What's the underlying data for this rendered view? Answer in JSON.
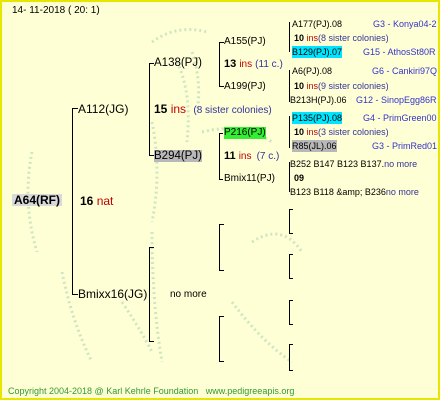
{
  "header": {
    "date": "14- 11-2018 ( 20: 1)"
  },
  "colors": {
    "frame": "#e6e600",
    "background": "#ffffd6",
    "root_box": "#d9d9d9",
    "gray_box": "#b8b8b8",
    "green_box": "#33ee33",
    "cyan_box": "#00e5ff",
    "ins_red": "#c00000",
    "link_blue": "#3333cc",
    "footer_green": "#339933"
  },
  "root": {
    "name": "A64(RF)",
    "ins_count": "16",
    "ins_label": "nat"
  },
  "gen1": {
    "father": {
      "name": "A112(JG)",
      "ins_count": "15",
      "ins_label": "ins",
      "note": "(8 sister colonies)"
    },
    "mother": {
      "name": "Bmixx16(JG)",
      "note": "no more"
    }
  },
  "gen2": {
    "ff": {
      "name": "A138(PJ)",
      "ins_count": "13",
      "ins_label": "ins",
      "note": "(11 c.)"
    },
    "fm": {
      "name": "B294(PJ)",
      "ins_count": "11",
      "ins_label": "ins",
      "note": "(7 c.)"
    }
  },
  "gen3": {
    "fff": {
      "name": "A155(PJ)"
    },
    "ffm": {
      "name": "A199(PJ)"
    },
    "fmf": {
      "name": "P216(PJ)"
    },
    "fmm": {
      "name": "Bmix11(PJ)"
    }
  },
  "gen4": {
    "rows": [
      {
        "name": "A177(PJ).08",
        "code": "G3 - Konya04-2"
      },
      {
        "ins_count": "10",
        "ins_label": "ins",
        "note": "(8 sister colonies)"
      },
      {
        "name": "B129(PJ).07",
        "code": "G15 - AthosSt80R"
      },
      {
        "name": "A6(PJ).08",
        "code": "G6 - Cankiri97Q"
      },
      {
        "ins_count": "10",
        "ins_label": "ins",
        "note": "(9 sister colonies)"
      },
      {
        "name": "B213H(PJ).06",
        "code": "G12 - SinopEgg86R"
      },
      {
        "name": "P135(PJ).08",
        "code": "G4 - PrimGreen00"
      },
      {
        "ins_count": "10",
        "ins_label": "ins",
        "note": "(3 sister colonies)"
      },
      {
        "name": "R85(JL).06",
        "code": "G3 - PrimRed01"
      },
      {
        "text": "B252 B147 B123 B137.",
        "note": "no more"
      },
      {
        "ins_count": "09",
        "ins_label": ""
      },
      {
        "text": "B123 B118 &amp; B236",
        "note": "no more"
      }
    ]
  },
  "footer": {
    "copyright": "Copyright 2004-2018 @ Karl Kehrle Foundation",
    "website": "www.pedigreeapis.org"
  }
}
